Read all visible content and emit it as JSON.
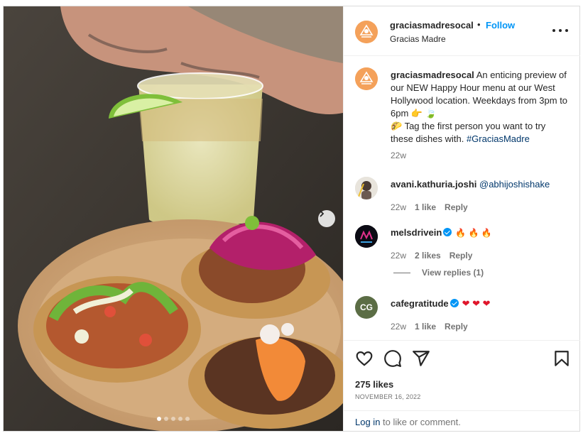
{
  "post": {
    "username": "gracias​madresocal",
    "separator": "•",
    "follow_label": "Follow",
    "location": "Gracias Madre",
    "more_icon": "more-horizontal-icon",
    "carousel_dots": 5,
    "carousel_active": 1
  },
  "caption": {
    "username": "graciasmadresocal",
    "text_part1": " An enticing preview of our NEW Happy Hour menu at our West Hollywood location. Weekdays from 3pm to 6pm ",
    "emoji1": "👉",
    "emoji2": "🍃",
    "emoji3": "🌮",
    "text_part2": " Tag the first person you want to try these dishes with. ",
    "hashtag": "#GraciasMadre",
    "time": "22w"
  },
  "comments": [
    {
      "username": "avani.kathuria.joshi",
      "text": "@abhijoshishake",
      "time": "22w",
      "likes": "1 like",
      "reply": "Reply"
    },
    {
      "username": "melsdrivein",
      "text": "🔥 🔥 🔥",
      "time": "22w",
      "likes": "2 likes",
      "reply": "Reply"
    },
    {
      "username": "cafegratitude",
      "text": "❤ ❤ ❤",
      "time": "22w",
      "likes": "1 like",
      "reply": "Reply",
      "avatar_initials": "CG"
    }
  ],
  "view_replies": "View replies (1)",
  "actions": {
    "like_icon": "heart-icon",
    "comment_icon": "comment-icon",
    "share_icon": "share-icon",
    "save_icon": "bookmark-icon"
  },
  "likes_count": "275 likes",
  "date": "NOVEMBER 16, 2022",
  "login": {
    "link": "Log in",
    "rest": " to like or comment."
  },
  "colors": {
    "accent": "#0095f6",
    "link": "#00376b",
    "muted": "#737373",
    "logo": "#f4a15a"
  }
}
